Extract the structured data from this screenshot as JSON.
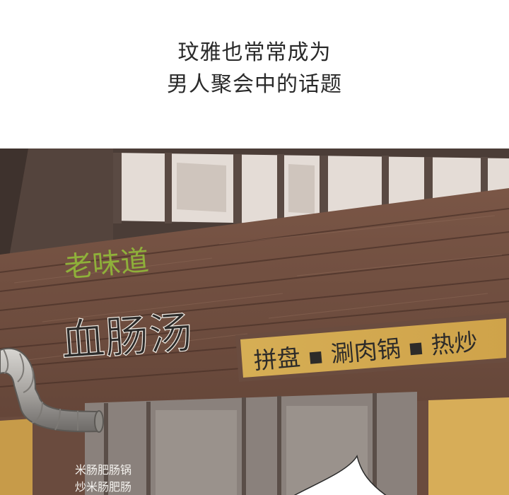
{
  "caption": {
    "line1": "玟雅也常常成为",
    "line2": "男人聚会中的话题"
  },
  "scene": {
    "sign_small": "老味道",
    "sign_main": "血肠汤",
    "sign_board": "拼盘 ▪ 涮肉锅 ▪ 热炒",
    "menu_line1": "米肠肥肠锅",
    "menu_line2": "炒米肠肥肠"
  },
  "colors": {
    "wood": "#6b4a3c",
    "wood_dark": "#4e3429",
    "sign_green": "#8fb03a",
    "board_bg": "#d2a94f",
    "text_dark": "#2a2a2a"
  }
}
